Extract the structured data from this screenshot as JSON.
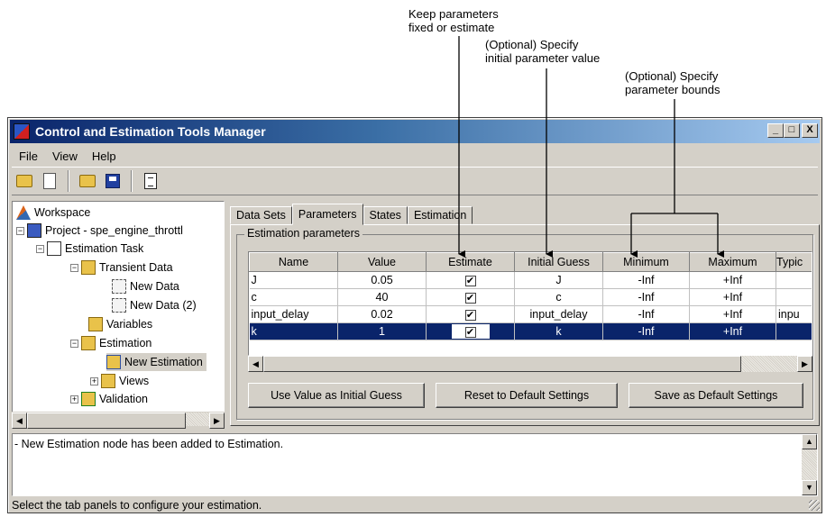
{
  "callouts": {
    "fixed_or_estimate_line1": "Keep parameters",
    "fixed_or_estimate_line2": "fixed or estimate",
    "initial_value_line1": "(Optional) Specify",
    "initial_value_line2": "initial parameter value",
    "bounds_line1": "(Optional) Specify",
    "bounds_line2": "parameter bounds"
  },
  "window": {
    "title": "Control and Estimation Tools Manager",
    "minimize": "_",
    "maximize": "□",
    "close": "X"
  },
  "menu": [
    "File",
    "View",
    "Help"
  ],
  "toolbar": {
    "icons": [
      "open-folder-icon",
      "new-document-icon",
      "open-icon",
      "save-icon",
      "clipboard-icon"
    ]
  },
  "tree": [
    {
      "label": "Workspace",
      "icon": "workspace-icon",
      "expander": ""
    },
    {
      "label": "Project - spe_engine_throttl",
      "icon": "project-icon",
      "expander": "−"
    },
    {
      "label": "Estimation Task",
      "icon": "task-icon",
      "expander": "−"
    },
    {
      "label": "Transient Data",
      "icon": "folder-icon",
      "expander": "−"
    },
    {
      "label": "New Data",
      "icon": "data-icon",
      "expander": ""
    },
    {
      "label": "New Data (2)",
      "icon": "data-icon",
      "expander": ""
    },
    {
      "label": "Variables",
      "icon": "variables-icon",
      "expander": ""
    },
    {
      "label": "Estimation",
      "icon": "estimation-icon",
      "expander": "−"
    },
    {
      "label": "New Estimation",
      "icon": "new-estimation-icon",
      "expander": ""
    },
    {
      "label": "Views",
      "icon": "views-icon",
      "expander": "+"
    },
    {
      "label": "Validation",
      "icon": "validation-icon",
      "expander": "+"
    }
  ],
  "tabs": [
    "Data Sets",
    "Parameters",
    "States",
    "Estimation"
  ],
  "active_tab": "Parameters",
  "group_title": "Estimation parameters",
  "table": {
    "columns": [
      "Name",
      "Value",
      "Estimate",
      "Initial Guess",
      "Minimum",
      "Maximum",
      "Typic"
    ],
    "rows": [
      {
        "name": "J",
        "value": "0.05",
        "estimate": "✔",
        "initial": "J",
        "min": "-Inf",
        "max": "+Inf",
        "typical": ""
      },
      {
        "name": "c",
        "value": "40",
        "estimate": "✔",
        "initial": "c",
        "min": "-Inf",
        "max": "+Inf",
        "typical": ""
      },
      {
        "name": "input_delay",
        "value": "0.02",
        "estimate": "✔",
        "initial": "input_delay",
        "min": "-Inf",
        "max": "+Inf",
        "typical": "inpu"
      },
      {
        "name": "k",
        "value": "1",
        "estimate": "✔",
        "initial": "k",
        "min": "-Inf",
        "max": "+Inf",
        "typical": ""
      }
    ]
  },
  "buttons": {
    "use_value": "Use Value as Initial Guess",
    "reset": "Reset to Default Settings",
    "save_default": "Save as Default Settings"
  },
  "message": "- New Estimation node has been added to Estimation.",
  "status": "Select the tab panels to configure your estimation."
}
